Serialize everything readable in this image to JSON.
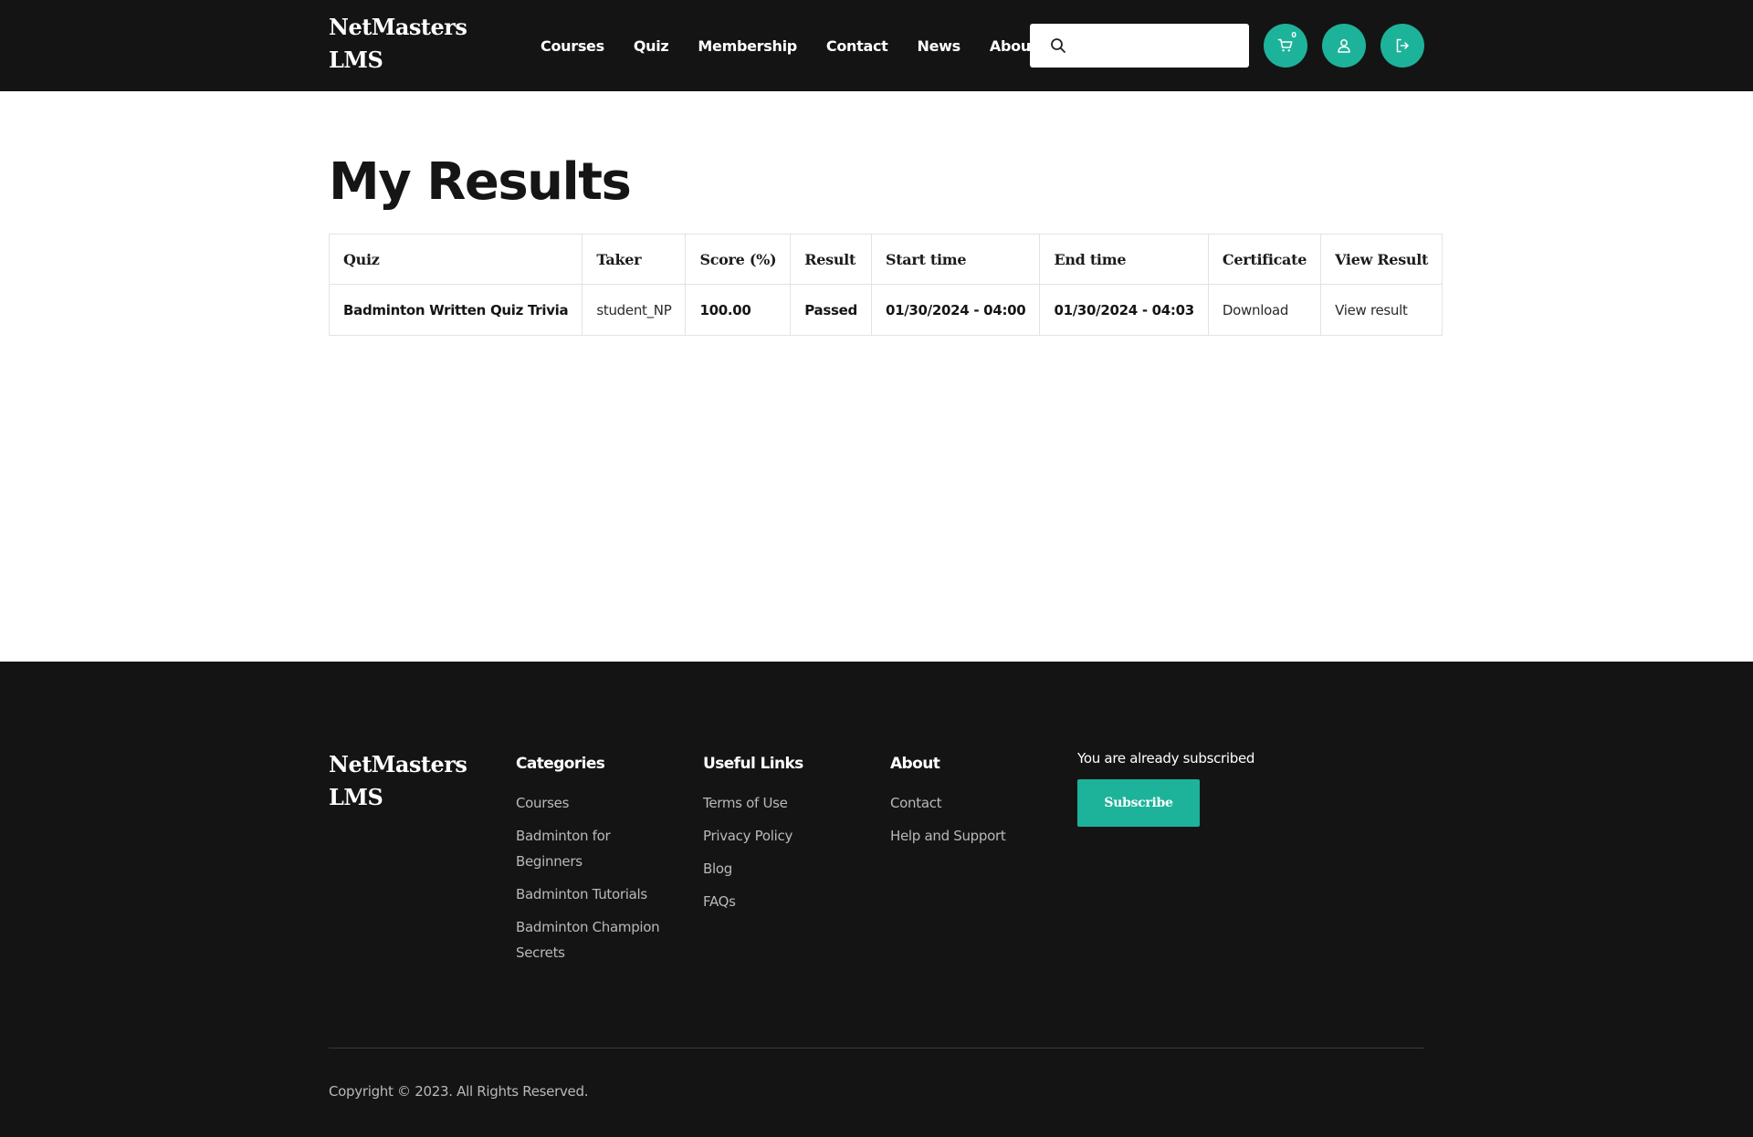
{
  "header": {
    "brand": "NetMasters LMS",
    "nav": [
      {
        "label": "Courses"
      },
      {
        "label": "Quiz"
      },
      {
        "label": "Membership"
      },
      {
        "label": "Contact"
      },
      {
        "label": "News"
      },
      {
        "label": "About"
      }
    ],
    "search_value": "",
    "cart_count": "0"
  },
  "main": {
    "title": "My Results",
    "table": {
      "headers": [
        "Quiz",
        "Taker",
        "Score (%)",
        "Result",
        "Start time",
        "End time",
        "Certificate",
        "View Result"
      ],
      "rows": [
        {
          "quiz": "Badminton Written Quiz Trivia",
          "taker": "student_NP",
          "score": "100.00",
          "result": "Passed",
          "start": "01/30/2024 - 04:00",
          "end": "01/30/2024 - 04:03",
          "certificate": "Download",
          "view": "View result"
        }
      ]
    }
  },
  "footer": {
    "brand": "NetMasters LMS",
    "categories": {
      "title": "Categories",
      "links": [
        "Courses",
        "Badminton for Beginners",
        "Badminton Tutorials",
        "Badminton Champion Secrets"
      ]
    },
    "useful_links": {
      "title": "Useful Links",
      "links": [
        "Terms of Use",
        "Privacy Policy",
        "Blog",
        "FAQs"
      ]
    },
    "about": {
      "title": "About",
      "links": [
        "Contact",
        "Help and Support"
      ]
    },
    "subscribe_text": "You are already subscribed",
    "subscribe_label": "Subscribe",
    "copyright": "Copyright © 2023. All Rights Reserved."
  },
  "colors": {
    "header_bg": "#141414",
    "accent": "#1db39a",
    "footer_bg": "#141414"
  }
}
